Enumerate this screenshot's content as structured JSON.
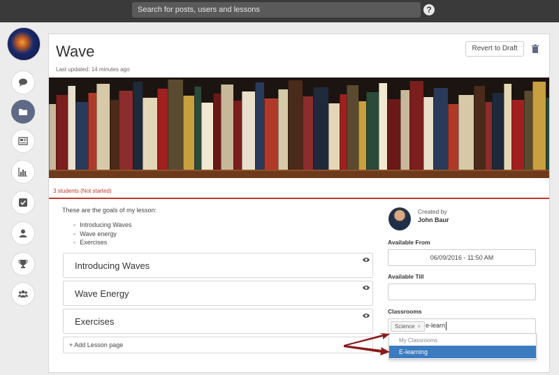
{
  "search": {
    "placeholder": "Search for posts, users and lessons",
    "icon": "question-icon",
    "help_glyph": "?"
  },
  "sidebar": {
    "items": [
      {
        "icon": "comment-icon"
      },
      {
        "icon": "folder-icon",
        "active": true
      },
      {
        "icon": "news-icon"
      },
      {
        "icon": "chart-icon"
      },
      {
        "icon": "checkbox-icon"
      },
      {
        "icon": "user-icon"
      },
      {
        "icon": "trophy-icon"
      },
      {
        "icon": "group-icon"
      }
    ]
  },
  "lesson": {
    "title": "Wave",
    "last_updated": "Last updated: 14 minutes ago",
    "revert_label": "Revert to Draft",
    "students_status": "3 students (Not started)",
    "goals_intro": "These are the goals of my lesson:",
    "goals": [
      "Introducing Waves",
      "Wave energy",
      "Exercises"
    ],
    "pages": [
      {
        "label": "Introducing Waves"
      },
      {
        "label": "Wave Energy"
      },
      {
        "label": "Exercises"
      }
    ],
    "add_page_label": "+ Add Lesson page"
  },
  "creator": {
    "label": "Created by",
    "name": "John Baur"
  },
  "availability": {
    "from_label": "Available From",
    "from_value": "06/09/2016 - 11:50 AM",
    "till_label": "Available Till",
    "till_value": ""
  },
  "classrooms": {
    "label": "Classrooms",
    "tag": "Science",
    "tag_remove": "×",
    "typed": "e-learn",
    "dropdown_group": "My Classrooms",
    "dropdown_option": "E-learning"
  },
  "colors": {
    "accent_red": "#c0392b",
    "selected_blue": "#3b7bc0",
    "active_nav": "#5e6a86",
    "arrow": "#8b1a1a"
  }
}
